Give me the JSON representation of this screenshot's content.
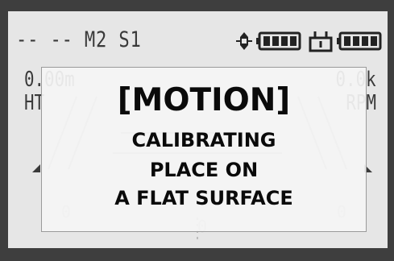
{
  "status": {
    "mode_text": "-- -- M2 S1",
    "icons": [
      "motion-sensor-icon",
      "battery-full-icon",
      "tripod-icon",
      "battery-full-icon"
    ]
  },
  "readouts": {
    "left_value": "0.00m",
    "left_unit": "HT",
    "right_value": "0.0k",
    "right_unit": "RPM",
    "zero_left": "0",
    "zero_center": "0",
    "zero_right": "0"
  },
  "dialog": {
    "title": "[MOTION]",
    "line1": "CALIBRATING",
    "line2": "PLACE ON",
    "line3": "A FLAT SURFACE"
  },
  "colors": {
    "screen_bg": "#e6e6e6",
    "bezel": "#3e3e3e",
    "lcd_ink": "#3a3a3a",
    "dialog_bg": "#f4f4f4",
    "dialog_text": "#0a0a0a"
  }
}
